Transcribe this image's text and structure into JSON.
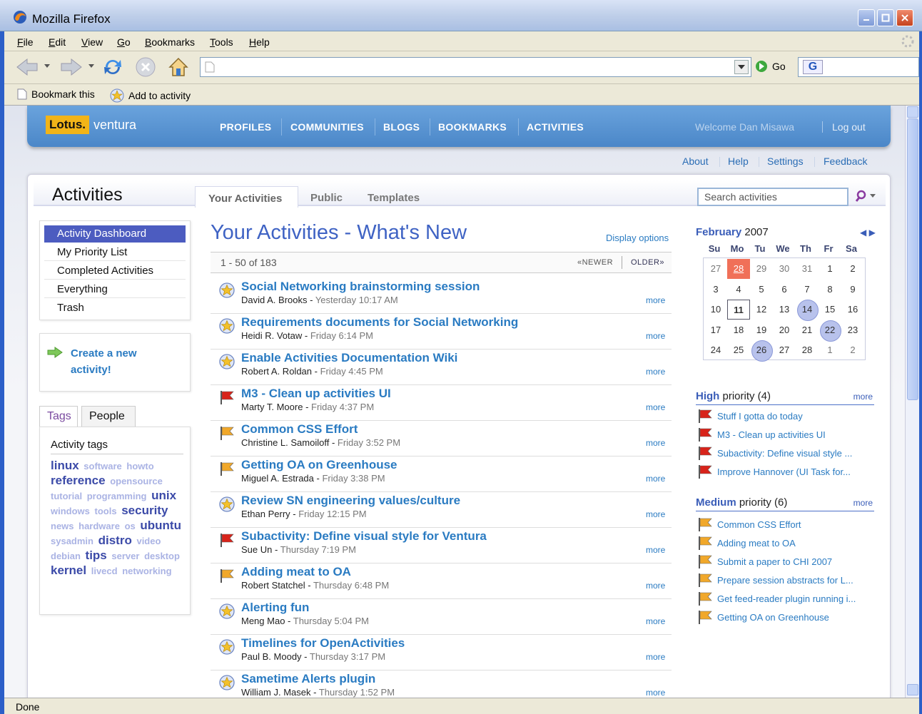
{
  "window": {
    "title": "Mozilla Firefox",
    "status": "Done"
  },
  "menu": [
    "File",
    "Edit",
    "View",
    "Go",
    "Bookmarks",
    "Tools",
    "Help"
  ],
  "toolbar": {
    "go_label": "Go"
  },
  "bookmarks": {
    "bookmark_this": "Bookmark this",
    "add_to_activity": "Add to activity"
  },
  "site": {
    "logo_brand": "Lotus.",
    "logo_product": "ventura",
    "nav": [
      "PROFILES",
      "COMMUNITIES",
      "BLOGS",
      "BOOKMARKS",
      "ACTIVITIES"
    ],
    "welcome": "Welcome Dan Misawa",
    "logout": "Log out",
    "links": [
      "About",
      "Help",
      "Settings",
      "Feedback"
    ]
  },
  "panel": {
    "title": "Activities",
    "tabs": [
      "Your Activities",
      "Public",
      "Templates"
    ],
    "search_placeholder": "Search activities"
  },
  "sidebar": {
    "items": [
      "Activity Dashboard",
      "My Priority List",
      "Completed Activities",
      "Everything",
      "Trash"
    ],
    "create": "Create a new activity!",
    "tag_tabs": [
      "Tags",
      "People"
    ],
    "tags_heading": "Activity tags",
    "tags": [
      {
        "t": "linux",
        "s": "big"
      },
      {
        "t": "software",
        "s": "small"
      },
      {
        "t": "howto",
        "s": "small"
      },
      {
        "t": "reference",
        "s": "big"
      },
      {
        "t": "opensource",
        "s": "small"
      },
      {
        "t": "tutorial",
        "s": "small"
      },
      {
        "t": "programming",
        "s": "small"
      },
      {
        "t": "unix",
        "s": "big"
      },
      {
        "t": "windows",
        "s": "small"
      },
      {
        "t": "tools",
        "s": "small"
      },
      {
        "t": "security",
        "s": "big"
      },
      {
        "t": "news",
        "s": "small"
      },
      {
        "t": "hardware",
        "s": "small"
      },
      {
        "t": "os",
        "s": "small"
      },
      {
        "t": "ubuntu",
        "s": "big"
      },
      {
        "t": "sysadmin",
        "s": "small"
      },
      {
        "t": "distro",
        "s": "big"
      },
      {
        "t": "video",
        "s": "small"
      },
      {
        "t": "debian",
        "s": "small"
      },
      {
        "t": "tips",
        "s": "big"
      },
      {
        "t": "server",
        "s": "small"
      },
      {
        "t": "desktop",
        "s": "small"
      },
      {
        "t": "kernel",
        "s": "big"
      },
      {
        "t": "livecd",
        "s": "small"
      },
      {
        "t": "networking",
        "s": "small"
      }
    ]
  },
  "main": {
    "title": "Your Activities - What's New",
    "display_options": "Display options",
    "count": "1 - 50 of 183",
    "newer": "«NEWER",
    "older": "OLDER»",
    "more": "more",
    "activities": [
      {
        "title": "Social Networking brainstorming session",
        "author": "David A. Brooks",
        "date": "Yesterday 10:17 AM",
        "icon": "star"
      },
      {
        "title": "Requirements documents for Social Networking",
        "author": "Heidi R. Votaw",
        "date": "Friday 6:14 PM",
        "icon": "star"
      },
      {
        "title": "Enable Activities Documentation Wiki",
        "author": "Robert A. Roldan",
        "date": "Friday 4:45 PM",
        "icon": "star"
      },
      {
        "title": "M3 - Clean up activities UI",
        "author": "Marty T. Moore",
        "date": "Friday 4:37 PM",
        "icon": "red-flag"
      },
      {
        "title": "Common CSS Effort",
        "author": "Christine L. Samoiloff",
        "date": "Friday 3:52 PM",
        "icon": "orange-flag"
      },
      {
        "title": "Getting OA on Greenhouse",
        "author": "Miguel A. Estrada",
        "date": "Friday 3:38 PM",
        "icon": "orange-flag"
      },
      {
        "title": "Review SN engineering values/culture",
        "author": "Ethan Perry",
        "date": "Friday 12:15 PM",
        "icon": "star"
      },
      {
        "title": "Subactivity: Define visual style for Ventura",
        "author": "Sue Un",
        "date": "Thursday 7:19 PM",
        "icon": "red-flag"
      },
      {
        "title": "Adding meat to OA",
        "author": "Robert Statchel",
        "date": "Thursday 6:48 PM",
        "icon": "orange-flag"
      },
      {
        "title": "Alerting fun",
        "author": "Meng Mao",
        "date": "Thursday 5:04 PM",
        "icon": "star"
      },
      {
        "title": "Timelines for OpenActivities",
        "author": "Paul B. Moody",
        "date": "Thursday 3:17 PM",
        "icon": "star"
      },
      {
        "title": "Sametime Alerts plugin",
        "author": "William J. Masek",
        "date": "Thursday 1:52 PM",
        "icon": "star"
      }
    ]
  },
  "calendar": {
    "month": "February",
    "year": "2007",
    "dow": [
      "Su",
      "Mo",
      "Tu",
      "We",
      "Th",
      "Fr",
      "Sa"
    ],
    "days": [
      [
        "27",
        "28",
        "29",
        "30",
        "31",
        "1",
        "2"
      ],
      [
        "3",
        "4",
        "5",
        "6",
        "7",
        "8",
        "9"
      ],
      [
        "10",
        "11",
        "12",
        "13",
        "14",
        "15",
        "16"
      ],
      [
        "17",
        "18",
        "19",
        "20",
        "21",
        "22",
        "23"
      ],
      [
        "24",
        "25",
        "26",
        "27",
        "28",
        "1",
        "2"
      ]
    ]
  },
  "high": {
    "label": "High",
    "rest": "priority (4)",
    "more": "more",
    "items": [
      "Stuff I gotta do today",
      "M3 - Clean up activities UI",
      "Subactivity: Define visual style ...",
      "Improve Hannover (UI Task for..."
    ]
  },
  "medium": {
    "label": "Medium",
    "rest": "priority (6)",
    "more": "more",
    "items": [
      "Common CSS Effort",
      "Adding meat to OA",
      "Submit a paper to CHI 2007",
      "Prepare session abstracts for L...",
      "Get feed-reader plugin running i...",
      "Getting OA on Greenhouse"
    ]
  },
  "colors": {
    "accent": "#2a7bc2",
    "nav": "#4b87c8",
    "title": "#3f63c4"
  }
}
